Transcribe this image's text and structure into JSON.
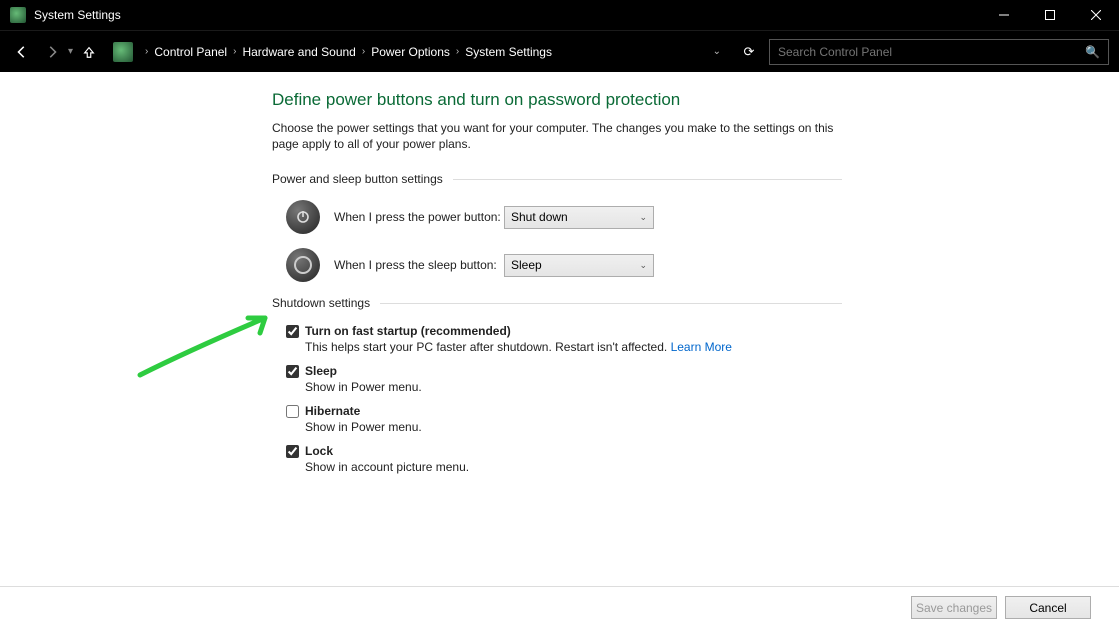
{
  "window": {
    "title": "System Settings"
  },
  "breadcrumbs": {
    "items": [
      "Control Panel",
      "Hardware and Sound",
      "Power Options",
      "System Settings"
    ]
  },
  "search": {
    "placeholder": "Search Control Panel"
  },
  "page": {
    "title": "Define power buttons and turn on password protection",
    "description": "Choose the power settings that you want for your computer. The changes you make to the settings on this page apply to all of your power plans."
  },
  "button_settings": {
    "heading": "Power and sleep button settings",
    "power_label": "When I press the power button:",
    "power_value": "Shut down",
    "sleep_label": "When I press the sleep button:",
    "sleep_value": "Sleep"
  },
  "shutdown": {
    "heading": "Shutdown settings",
    "fast_startup": {
      "checked": true,
      "title": "Turn on fast startup (recommended)",
      "desc": "This helps start your PC faster after shutdown. Restart isn't affected. ",
      "link": "Learn More"
    },
    "sleep": {
      "checked": true,
      "title": "Sleep",
      "desc": "Show in Power menu."
    },
    "hibernate": {
      "checked": false,
      "title": "Hibernate",
      "desc": "Show in Power menu."
    },
    "lock": {
      "checked": true,
      "title": "Lock",
      "desc": "Show in account picture menu."
    }
  },
  "footer": {
    "save": "Save changes",
    "cancel": "Cancel"
  }
}
